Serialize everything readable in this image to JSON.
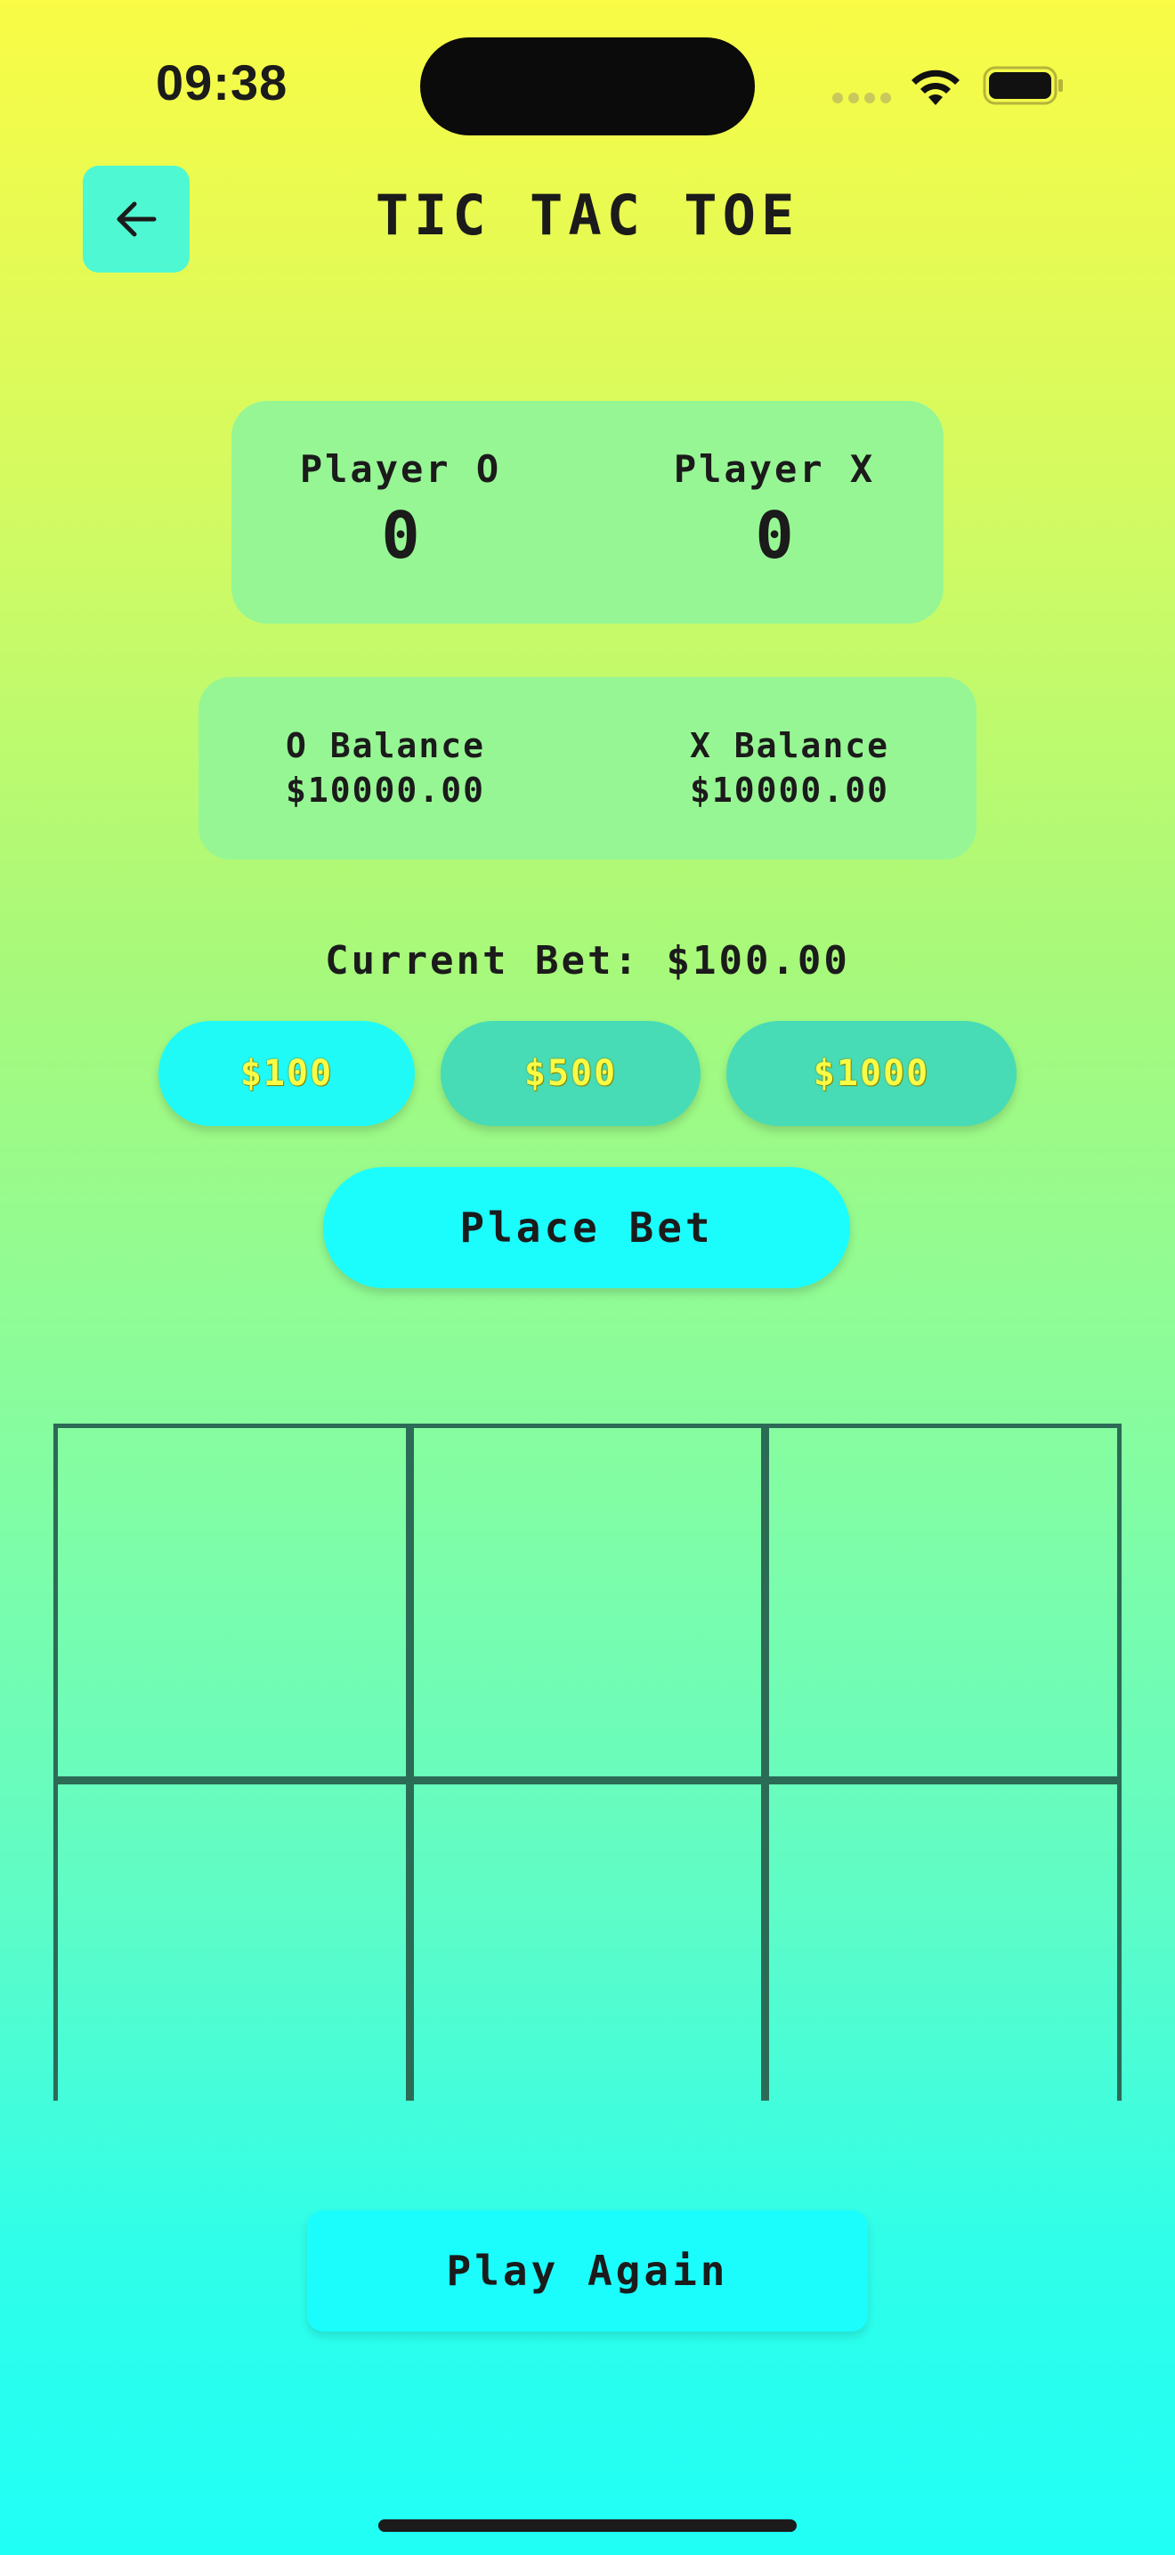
{
  "status_bar": {
    "time": "09:38"
  },
  "header": {
    "title": "TIC TAC TOE",
    "back_icon": "arrow-left-icon"
  },
  "scores": {
    "player_o": {
      "label": "Player O",
      "value": "0"
    },
    "player_x": {
      "label": "Player X",
      "value": "0"
    }
  },
  "balances": {
    "o": {
      "label": "O Balance",
      "value": "$10000.00"
    },
    "x": {
      "label": "X Balance",
      "value": "$10000.00"
    }
  },
  "bet": {
    "current_label": "Current Bet: $100.00",
    "chips": [
      "$100",
      "$500",
      "$1000"
    ],
    "selected_chip": "$100",
    "place_bet_label": "Place Bet"
  },
  "board": {
    "cells": [
      "",
      "",
      "",
      "",
      "",
      ""
    ]
  },
  "actions": {
    "play_again_label": "Play Again"
  },
  "colors": {
    "card": "#97F694",
    "accent": "#1BFDFD",
    "chip_unselected": "#47DCB6",
    "grid_line": "#2B6B55",
    "chip_text": "#F9FB45"
  }
}
